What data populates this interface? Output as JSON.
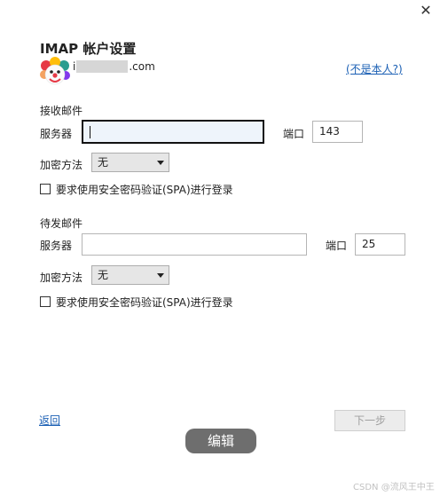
{
  "window": {
    "title": "IMAP 帐户设置",
    "close_glyph": "✕",
    "close_icon": "close-icon"
  },
  "account": {
    "email_prefix": "i",
    "email_suffix": ".com",
    "not_me_link": "(不是本人?)",
    "avatar_icon": "clown-avatar-icon"
  },
  "incoming": {
    "section_label": "接收邮件",
    "server_label": "服务器",
    "server_value": "",
    "port_label": "端口",
    "port_value": "143",
    "encryption_label": "加密方法",
    "encryption_value": "无",
    "spa_label": "要求使用安全密码验证(SPA)进行登录",
    "spa_checked": false
  },
  "outgoing": {
    "section_label": "待发邮件",
    "server_label": "服务器",
    "server_value": "",
    "port_label": "端口",
    "port_value": "25",
    "encryption_label": "加密方法",
    "encryption_value": "无",
    "spa_label": "要求使用安全密码验证(SPA)进行登录",
    "spa_checked": false
  },
  "footer": {
    "back_link": "返回",
    "next_button": "下一步",
    "edit_button": "编辑"
  },
  "watermark": "CSDN @流风王中王",
  "colors": {
    "link": "#1a5fb4",
    "edit_button_bg": "#6e6e6e",
    "focused_input_bg": "#eef4fb"
  }
}
